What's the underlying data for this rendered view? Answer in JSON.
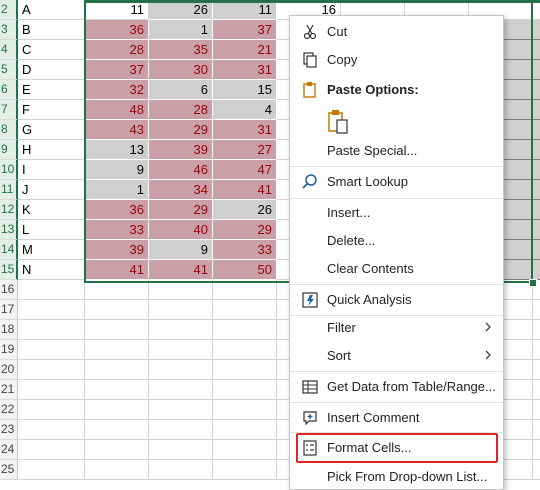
{
  "sheet": {
    "rows": [
      {
        "num": "2",
        "label": "A",
        "b": "11",
        "c": "26",
        "d": "11",
        "e": "16",
        "colors": [
          "plain",
          "gray",
          "gray"
        ]
      },
      {
        "num": "3",
        "label": "B",
        "b": "36",
        "c": "1",
        "d": "37",
        "colors": [
          "pink",
          "gray",
          "pink"
        ]
      },
      {
        "num": "4",
        "label": "C",
        "b": "28",
        "c": "35",
        "d": "21",
        "colors": [
          "pink",
          "pink",
          "pink"
        ]
      },
      {
        "num": "5",
        "label": "D",
        "b": "37",
        "c": "30",
        "d": "31",
        "colors": [
          "pink",
          "pink",
          "pink"
        ]
      },
      {
        "num": "6",
        "label": "E",
        "b": "32",
        "c": "6",
        "d": "15",
        "colors": [
          "pink",
          "gray",
          "gray"
        ]
      },
      {
        "num": "7",
        "label": "F",
        "b": "48",
        "c": "28",
        "d": "4",
        "colors": [
          "pink",
          "pink",
          "gray"
        ]
      },
      {
        "num": "8",
        "label": "G",
        "b": "43",
        "c": "29",
        "d": "31",
        "colors": [
          "pink",
          "pink",
          "pink"
        ]
      },
      {
        "num": "9",
        "label": "H",
        "b": "13",
        "c": "39",
        "d": "27",
        "colors": [
          "gray",
          "pink",
          "pink"
        ]
      },
      {
        "num": "10",
        "label": "I",
        "b": "9",
        "c": "46",
        "d": "47",
        "colors": [
          "gray",
          "pink",
          "pink"
        ]
      },
      {
        "num": "11",
        "label": "J",
        "b": "1",
        "c": "34",
        "d": "41",
        "colors": [
          "gray",
          "pink",
          "pink"
        ]
      },
      {
        "num": "12",
        "label": "K",
        "b": "36",
        "c": "29",
        "d": "26",
        "colors": [
          "pink",
          "pink",
          "gray"
        ]
      },
      {
        "num": "13",
        "label": "L",
        "b": "33",
        "c": "40",
        "d": "29",
        "colors": [
          "pink",
          "pink",
          "pink"
        ]
      },
      {
        "num": "14",
        "label": "M",
        "b": "39",
        "c": "9",
        "d": "33",
        "colors": [
          "pink",
          "gray",
          "pink"
        ]
      },
      {
        "num": "15",
        "label": "N",
        "b": "41",
        "c": "41",
        "d": "50",
        "colors": [
          "pink",
          "pink",
          "pink"
        ]
      }
    ],
    "empty_rows": [
      "16",
      "17",
      "18",
      "19",
      "20",
      "21",
      "22",
      "23",
      "24",
      "25"
    ]
  },
  "menu": {
    "items": {
      "cut": "Cut",
      "copy": "Copy",
      "paste_options": "Paste Options:",
      "paste_special": "Paste Special...",
      "smart_lookup": "Smart Lookup",
      "insert": "Insert...",
      "delete": "Delete...",
      "clear_contents": "Clear Contents",
      "quick_analysis": "Quick Analysis",
      "filter": "Filter",
      "sort": "Sort",
      "get_data": "Get Data from Table/Range...",
      "insert_comment": "Insert Comment",
      "format_cells": "Format Cells...",
      "pick_dropdown": "Pick From Drop-down List..."
    }
  },
  "colors": {
    "accent": "#217346",
    "highlight_box": "#e02424",
    "pink_fill": "#c9a0a8",
    "pink_text": "#9c0006",
    "gray_fill": "#cfcfcf"
  }
}
